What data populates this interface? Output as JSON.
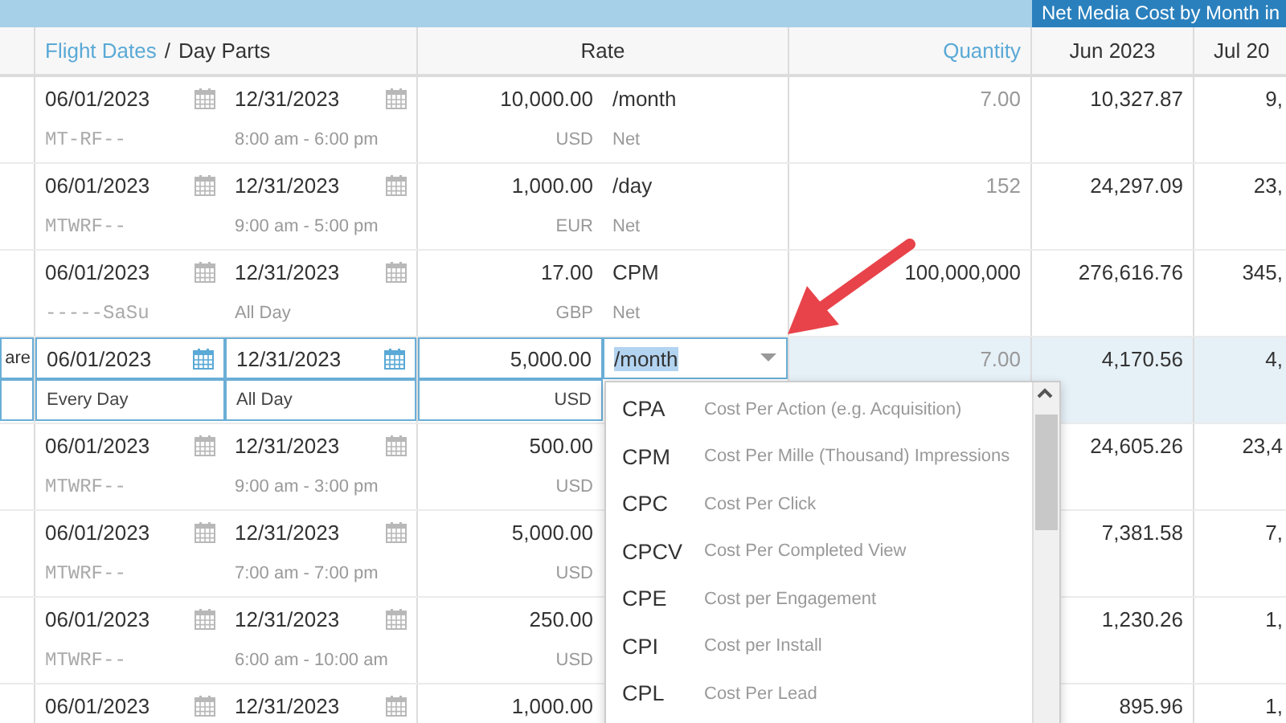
{
  "header_band": {
    "title": "Net Media Cost by Month in"
  },
  "columns": {
    "flight_dates": "Flight Dates",
    "separator": "/",
    "day_parts": "Day Parts",
    "rate": "Rate",
    "quantity": "Quantity",
    "month_1": "Jun 2023",
    "month_2": "Jul 20"
  },
  "rows": [
    {
      "editing": false,
      "start": "06/01/2023",
      "end": "12/31/2023",
      "days": "MT-RF--",
      "times": "8:00 am - 6:00 pm",
      "amount": "10,000.00",
      "currency": "USD",
      "unit": "/month",
      "unit_note": "Net",
      "quantity": "7.00",
      "quantity_dimmed": true,
      "month_1": "10,327.87",
      "month_2": "9,"
    },
    {
      "editing": false,
      "start": "06/01/2023",
      "end": "12/31/2023",
      "days": "MTWRF--",
      "times": "9:00 am - 5:00 pm",
      "amount": "1,000.00",
      "currency": "EUR",
      "unit": "/day",
      "unit_note": "Net",
      "quantity": "152",
      "quantity_dimmed": true,
      "month_1": "24,297.09",
      "month_2": "23,"
    },
    {
      "editing": false,
      "start": "06/01/2023",
      "end": "12/31/2023",
      "days": "-----SaSu",
      "times": "All Day",
      "amount": "17.00",
      "currency": "GBP",
      "unit": "CPM",
      "unit_note": "Net",
      "quantity": "100,000,000",
      "quantity_dimmed": false,
      "month_1": "276,616.76",
      "month_2": "345,"
    },
    {
      "editing": true,
      "column_1": "are",
      "start": "06/01/2023",
      "end": "12/31/2023",
      "days": "Every Day",
      "times": "All Day",
      "amount": "5,000.00",
      "currency": "USD",
      "unit": "/month",
      "quantity": "7.00",
      "quantity_dimmed": true,
      "month_1": "4,170.56",
      "month_2": "4,"
    },
    {
      "editing": false,
      "start": "06/01/2023",
      "end": "12/31/2023",
      "days": "MTWRF--",
      "times": "9:00 am - 3:00 pm",
      "amount": "500.00",
      "currency": "USD",
      "month_1": "24,605.26",
      "month_2": "23,4"
    },
    {
      "editing": false,
      "start": "06/01/2023",
      "end": "12/31/2023",
      "days": "MTWRF--",
      "times": "7:00 am - 7:00 pm",
      "amount": "5,000.00",
      "currency": "USD",
      "month_1": "7,381.58",
      "month_2": "7,"
    },
    {
      "editing": false,
      "start": "06/01/2023",
      "end": "12/31/2023",
      "days": "MTWRF--",
      "times": "6:00 am - 10:00 am",
      "amount": "250.00",
      "currency": "USD",
      "month_1": "1,230.26",
      "month_2": "1,"
    },
    {
      "editing": false,
      "start": "06/01/2023",
      "end": "12/31/2023",
      "amount": "1,000.00",
      "month_1": "895.96",
      "month_2": "1,"
    }
  ],
  "rate_dropdown": {
    "options": [
      {
        "code": "CPA",
        "description": "Cost Per Action (e.g. Acquisition)"
      },
      {
        "code": "CPM",
        "description": "Cost Per Mille (Thousand) Impressions"
      },
      {
        "code": "CPC",
        "description": "Cost Per Click"
      },
      {
        "code": "CPCV",
        "description": "Cost Per Completed View"
      },
      {
        "code": "CPE",
        "description": "Cost per Engagement"
      },
      {
        "code": "CPI",
        "description": "Cost per Install"
      },
      {
        "code": "CPL",
        "description": "Cost Per Lead"
      }
    ]
  }
}
